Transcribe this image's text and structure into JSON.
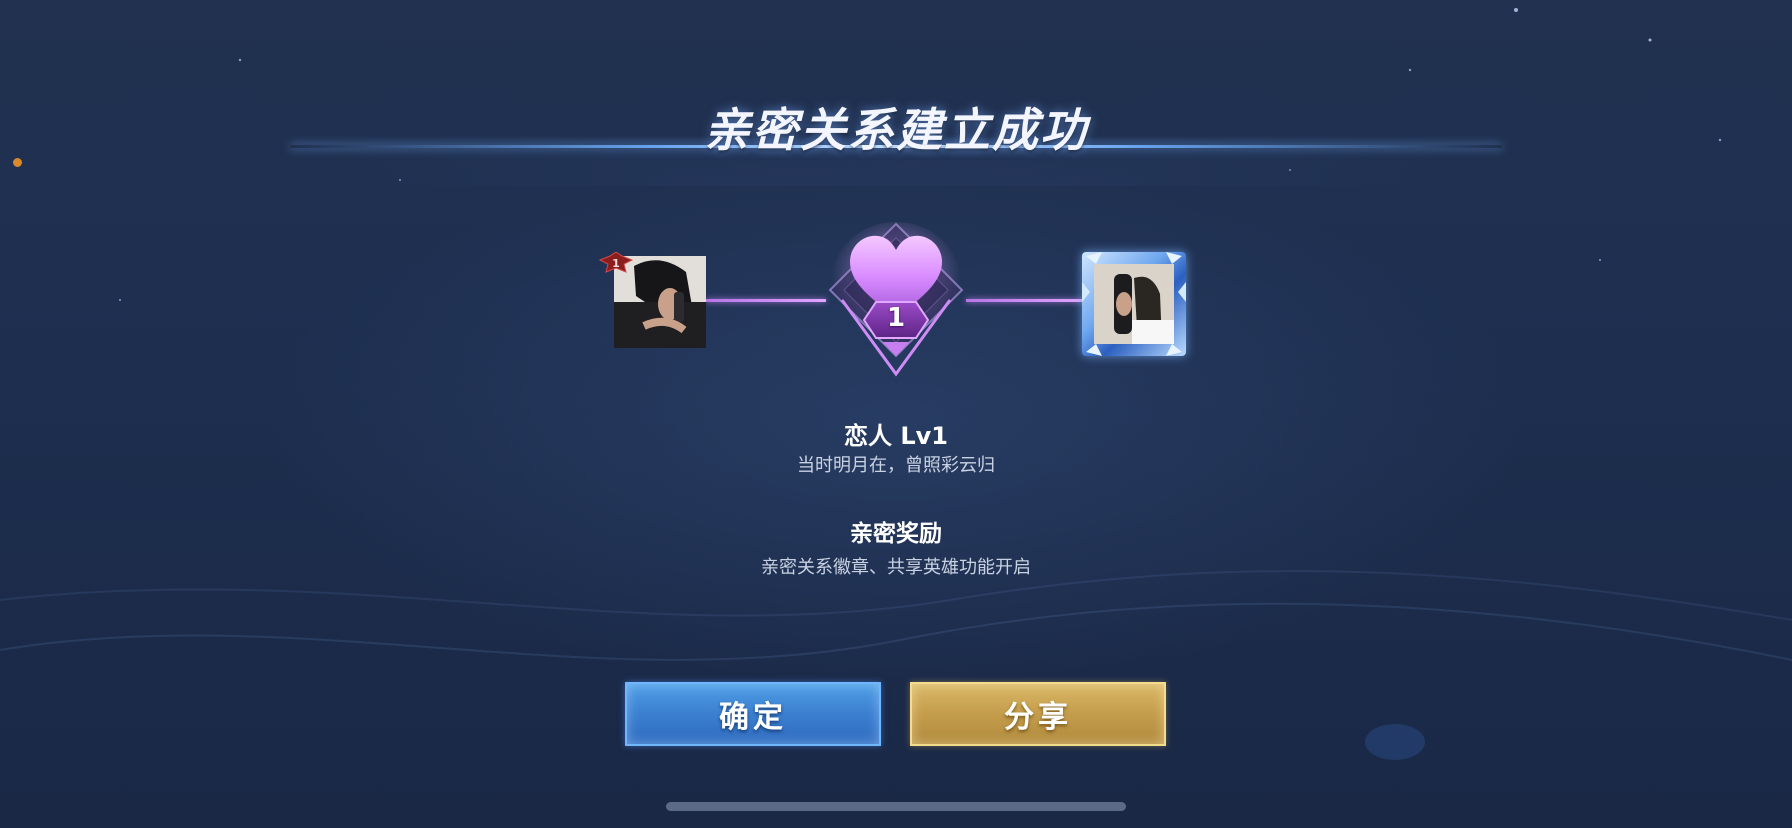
{
  "dialog": {
    "title": "亲密关系建立成功",
    "intimacy_level": "1",
    "relationship_name": "恋人 Lv1",
    "relationship_quote": "当时明月在，曾照彩云归",
    "reward_title": "亲密奖励",
    "reward_desc": "亲密关系徽章、共享英雄功能开启"
  },
  "player_left": {
    "rank_badge": "1"
  },
  "buttons": {
    "confirm_label": "确定",
    "share_label": "分享"
  },
  "colors": {
    "accent_blue": "#3b7fd0",
    "accent_gold": "#c49d4c",
    "heart_pink": "#d98cff",
    "background": "#1e2f50"
  },
  "icons": {
    "heart": "heart-icon",
    "rank_badge": "rank-badge-icon"
  }
}
